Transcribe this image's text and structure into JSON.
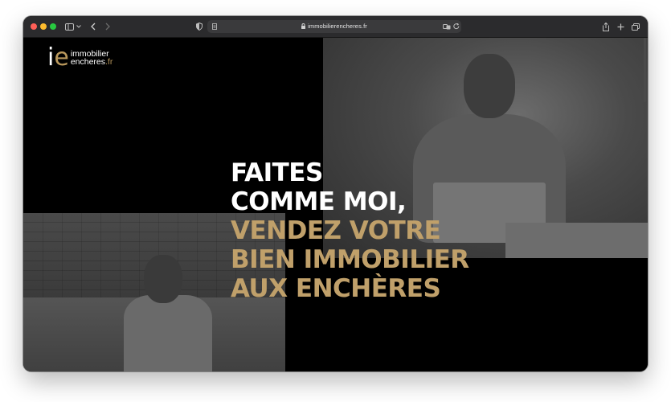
{
  "browser": {
    "url": "immobilierencheres.fr"
  },
  "logo": {
    "mark_i": "i",
    "mark_e": "e",
    "line1": "immobilier",
    "line2_main": "encheres",
    "line2_suffix": ".fr"
  },
  "hero": {
    "line1": "FAITES",
    "line2": "COMME MOI,",
    "line3": "VENDEZ VOTRE",
    "line4": "BIEN IMMOBILIER",
    "line5": "AUX ENCHÈRES"
  },
  "colors": {
    "brand_gold": "#c0a06a",
    "background": "#000000",
    "text_white": "#ffffff"
  },
  "icons": [
    "sidebar-icon",
    "chevron-left-icon",
    "chevron-right-icon",
    "shield-icon",
    "reader-icon",
    "lock-icon",
    "translate-icon",
    "reload-icon",
    "share-icon",
    "new-tab-icon",
    "tab-overview-icon"
  ]
}
